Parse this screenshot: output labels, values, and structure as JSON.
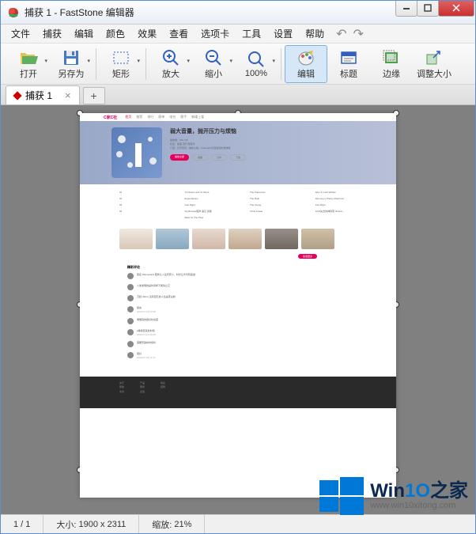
{
  "titlebar": {
    "title": "捕获 1 - FastStone 编辑器"
  },
  "menu": {
    "file": "文件",
    "capture": "捕获",
    "edit": "编辑",
    "color": "颜色",
    "effect": "效果",
    "view": "查看",
    "tabs": "选项卡",
    "tool": "工具",
    "settings": "设置",
    "help": "帮助"
  },
  "toolbar": {
    "open": "打开",
    "saveas": "另存为",
    "rect": "矩形",
    "zoomin": "放大",
    "zoomout": "缩小",
    "z100": "100%",
    "edit": "编辑",
    "title": "标题",
    "edge": "边缘",
    "resize": "调整大小"
  },
  "tab": {
    "name": "捕获 1",
    "plus": "+"
  },
  "preview": {
    "logo": "C家C社",
    "nav": [
      "首页",
      "推荐",
      "排行",
      "歌单",
      "电台",
      "歌手",
      "新碟上架"
    ],
    "hero_title": "弱大音量，抛开压力与烦恼",
    "hero_sub1": "播放量：252,745",
    "hero_sub2": "标签：欧美  流行  轻音乐",
    "hero_sub3": "介绍：打开音乐，放松心情，Cinematic打造最佳听觉体验",
    "btn_play": "播放全部",
    "btn_fav": "收藏",
    "btn_share": "分享",
    "btn_dl": "下载",
    "tracks": [
      [
        "01",
        "To Dream and To Move",
        "",
        "The Papercuts",
        "After It Lush Whites"
      ],
      [
        "02",
        "Expectations",
        "",
        "The Rain",
        "Afternoon, Plenty Afternoon"
      ],
      [
        "03",
        "Just Right",
        "",
        "The Young",
        "Just Right"
      ],
      [
        "04",
        "Synthesise旋律 遇见 就像",
        "",
        "Chris Cowie",
        "1221失去的神的家 Illusion…"
      ]
    ],
    "section": "Back To The Past",
    "pill": "加载更多",
    "comments_title": "精彩评论",
    "comments": [
      {
        "user": "匿名 Shunyuan2",
        "text": "陪伴让人生有意义，时光让岁月有痕迹",
        "date": ""
      },
      {
        "user": "",
        "text": "人类发明的是时间却不能停止它",
        "date": ""
      },
      {
        "user": "沉默 (Nico)",
        "text": "没有回忆的人生是苍白的",
        "date": ""
      },
      {
        "user": "",
        "text": "留言",
        "date": "2020-07-16 23:38"
      },
      {
        "user": "",
        "text": "啊啊真的很好听这首",
        "date": ""
      },
      {
        "user": "",
        "text": "●等我回来的时候",
        "date": "2020-07-16 09:08"
      },
      {
        "user": "",
        "text": "需要安静的时候听",
        "date": ""
      },
      {
        "user": "",
        "text": "很好",
        "date": "2020-07-15 11:11"
      }
    ]
  },
  "status": {
    "page": "1 / 1",
    "size_label": "大小:",
    "size_value": "1900 x 2311",
    "zoom_label": "缩放:",
    "zoom_value": "21%"
  },
  "watermark": {
    "brand_a": "Win",
    "brand_b": "1O",
    "brand_c": "之家",
    "url": "www.win10xitong.com"
  }
}
